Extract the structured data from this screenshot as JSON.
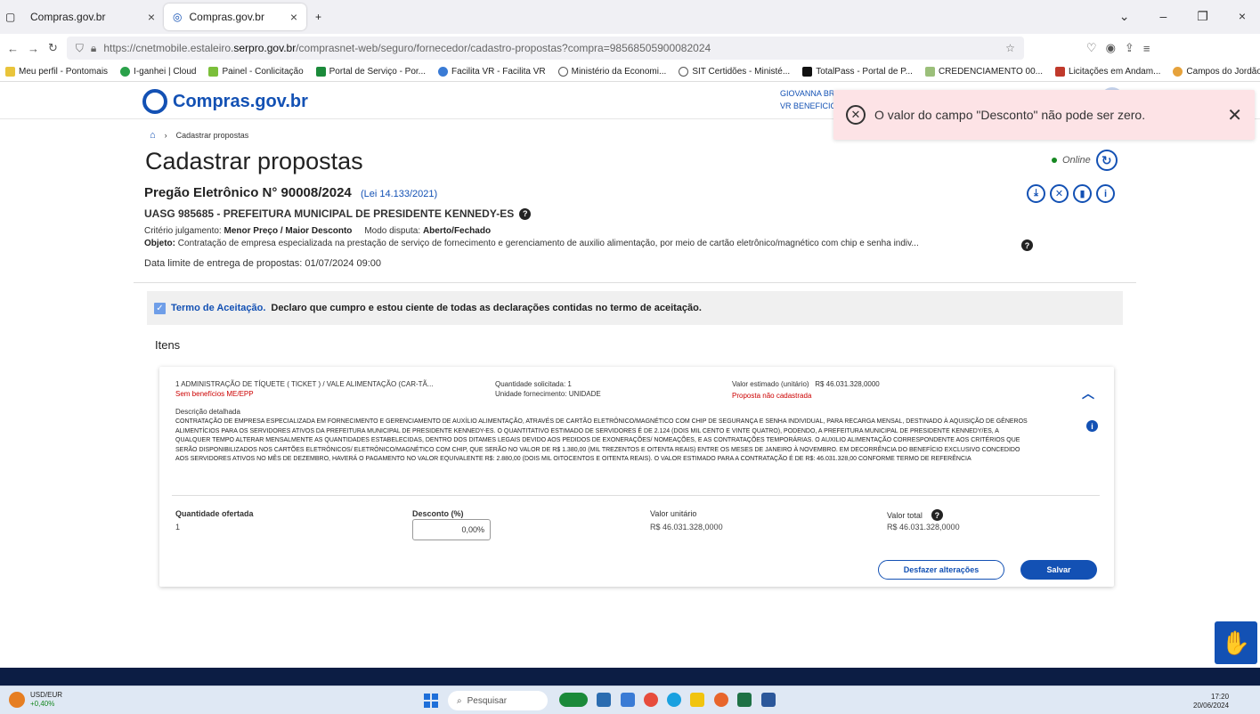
{
  "browser": {
    "tabs": [
      {
        "label": "Compras.gov.br"
      },
      {
        "label": "Compras.gov.br"
      }
    ],
    "url_prefix": "https://cnetmobile.estaleiro.",
    "url_domain": "serpro.gov.br",
    "url_path": "/comprasnet-web/seguro/fornecedor/cadastro-propostas?compra=98568505900082024",
    "bookmarks": [
      "Meu perfil - Pontomais",
      "I-ganhei | Cloud",
      "Painel - Conlicitação",
      "Portal de Serviço - Por...",
      "Facilita VR - Facilita VR",
      "Ministério da Economi...",
      "SIT Certidões - Ministé...",
      "TotalPass - Portal de P...",
      "CREDENCIAMENTO 00...",
      "Licitações em Andam...",
      "Campos do Jordão Pre..."
    ]
  },
  "header": {
    "logo": "Compras.gov.br",
    "user_line1": "GIOVANNA BRANCO DE MORAES ALMEIDA SORRO | 457124.698-63",
    "user_line2": "VR BENEFICIOS"
  },
  "toast": {
    "message": "O valor do campo \"Desconto\" não pode ser zero."
  },
  "breadcrumb": {
    "current": "Cadastrar propostas"
  },
  "page": {
    "title": "Cadastrar propostas",
    "status": "Online",
    "pregao": "Pregão Eletrônico N° 90008/2024",
    "lei": "(Lei 14.133/2021)",
    "uasg": "UASG 985685 - PREFEITURA MUNICIPAL DE PRESIDENTE KENNEDY-ES",
    "criterio_label": "Critério julgamento:",
    "criterio_value": "Menor Preço / Maior Desconto",
    "modo_label": "Modo disputa:",
    "modo_value": "Aberto/Fechado",
    "objeto_label": "Objeto:",
    "objeto_value": "Contratação de empresa especializada na prestação de serviço de fornecimento e gerenciamento de auxilio alimentação, por meio de cartão eletrônico/magnético com chip e senha indiv...",
    "data_limite_label": "Data limite de entrega de propostas:",
    "data_limite_value": "01/07/2024 09:00"
  },
  "terms": {
    "link": "Termo de Aceitação.",
    "text": "Declaro que cumpro e estou ciente de todas as declarações contidas no termo de aceitação."
  },
  "itens": {
    "title": "Itens",
    "item": {
      "title": "1  ADMINISTRAÇÃO DE TÍQUETE ( TICKET ) / VALE ALIMENTAÇÃO (CAR-TÃ...",
      "beneficio": "Sem benefícios ME/EPP",
      "qtd_label": "Quantidade solicitada:",
      "qtd_value": "1",
      "unid_label": "Unidade fornecimento:",
      "unid_value": "UNIDADE",
      "valor_est_label": "Valor estimado (unitário)",
      "valor_est_value": "R$ 46.031.328,0000",
      "proposta_status": "Proposta não cadastrada",
      "desc_label": "Descrição detalhada",
      "desc_text": "CONTRATAÇÃO DE EMPRESA ESPECIALIZADA EM FORNECIMENTO E GERENCIAMENTO DE AUXÍLIO ALIMENTAÇÃO, ATRAVÉS DE CARTÃO ELETRÔNICO/MAGNÉTICO COM CHIP DE SEGURANÇA E SENHA INDIVIDUAL, PARA RECARGA MENSAL, DESTINADO À AQUISIÇÃO DE GÊNEROS ALIMENTÍCIOS PARA OS SERVIDORES ATIVOS DA PREFEITURA MUNICIPAL DE PRESIDENTE KENNEDY-ES. O QUANTITATIVO ESTIMADO DE SERVIDORES É DE 2.124 (DOIS MIL CENTO E VINTE QUATRO), PODENDO, A PREFEITURA MUNICIPAL DE PRESIDENTE KENNEDY/ES, A QUALQUER TEMPO ALTERAR MENSALMENTE AS QUANTIDADES ESTABELECIDAS, DENTRO DOS DITAMES LEGAIS DEVIDO AOS PEDIDOS DE EXONERAÇÕES/ NOMEAÇÕES, E AS CONTRATAÇÕES TEMPORÁRIAS. O AUXILIO ALIMENTAÇÃO CORRESPONDENTE AOS CRITÉRIOS QUE SERÃO DISPONIBILIZADOS NOS CARTÕES ELETRÔNICOS/ ELETRÔNICO/MAGNÉTICO COM CHIP, QUE SERÃO NO VALOR DE R$ 1.380,00 (MIL TREZENTOS E OITENTA REAIS) ENTRE OS MESES DE JANEIRO À NOVEMBRO. EM DECORRÊNCIA DO BENEFÍCIO EXCLUSIVO CONCEDIDO AOS SERVIDORES ATIVOS NO MÊS DE DEZEMBRO, HAVERÁ O PAGAMENTO NO VALOR EQUIVALENTE R$: 2.880,00 (DOIS MIL OITOCENTOS E OITENTA REAIS). O VALOR ESTIMADO PARA A CONTRATAÇÃO É DE R$: 46.031.328,00   CONFORME TERMO DE REFERÊNCIA",
      "qtd_ofertada_label": "Quantidade ofertada",
      "qtd_ofertada_value": "1",
      "desconto_label": "Desconto (%)",
      "desconto_value": "0,00%",
      "valor_unit_label": "Valor unitário",
      "valor_unit_value": "R$ 46.031.328,0000",
      "valor_total_label": "Valor total",
      "valor_total_value": "R$ 46.031.328,0000",
      "btn_desfazer": "Desfazer alterações",
      "btn_salvar": "Salvar"
    }
  },
  "taskbar": {
    "ticker_name": "USD/EUR",
    "ticker_change": "+0,40%",
    "search_placeholder": "Pesquisar",
    "time": "17:20",
    "date": "20/06/2024"
  }
}
